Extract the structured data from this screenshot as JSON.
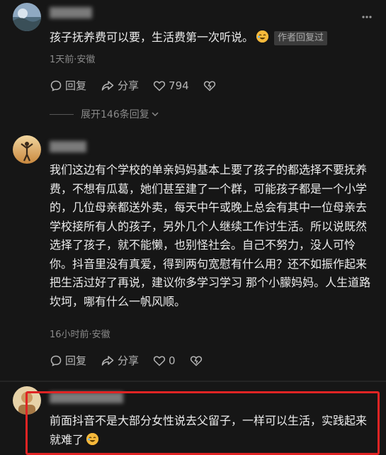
{
  "comments": [
    {
      "text": "孩子抚养费可以要，生活费第一次听说。",
      "badge": "作者回复过",
      "meta": "1天前·安徽",
      "reply_label": "回复",
      "share_label": "分享",
      "like_count": "794",
      "expand_label": "展开146条回复"
    },
    {
      "text": "我们这边有个学校的单亲妈妈基本上要了孩子的都选择不要抚养费，不想有瓜葛，她们甚至建了一个群，可能孩子都是一个小学的，几位母亲都送外卖，每天中午或晚上总会有其中一位母亲去学校接所有人的孩子，另外几个人继续工作讨生活。所以说既然选择了孩子，就不能懒，也别怪社会。自己不努力，没人可怜你。抖音里没有真爱，得到两句宽慰有什么用？还不如振作起来把生活过好了再说，建议你多学习学习 那个小朦妈妈。人生道路坎坷，哪有什么一帆风顺。",
      "meta": "16小时前·安徽",
      "reply_label": "回复",
      "share_label": "分享",
      "like_count": "0"
    },
    {
      "text": "前面抖音不是大部分女性说去父留子，一样可以生活，实践起来就难了"
    }
  ],
  "colors": {
    "background": "#161616",
    "highlight_border": "#e02424",
    "badge_bg": "#3b3b3b"
  },
  "icons": [
    "more-icon",
    "reply-icon",
    "share-icon",
    "like-icon",
    "dislike-icon",
    "chevron-down-icon",
    "emoji-icon"
  ]
}
